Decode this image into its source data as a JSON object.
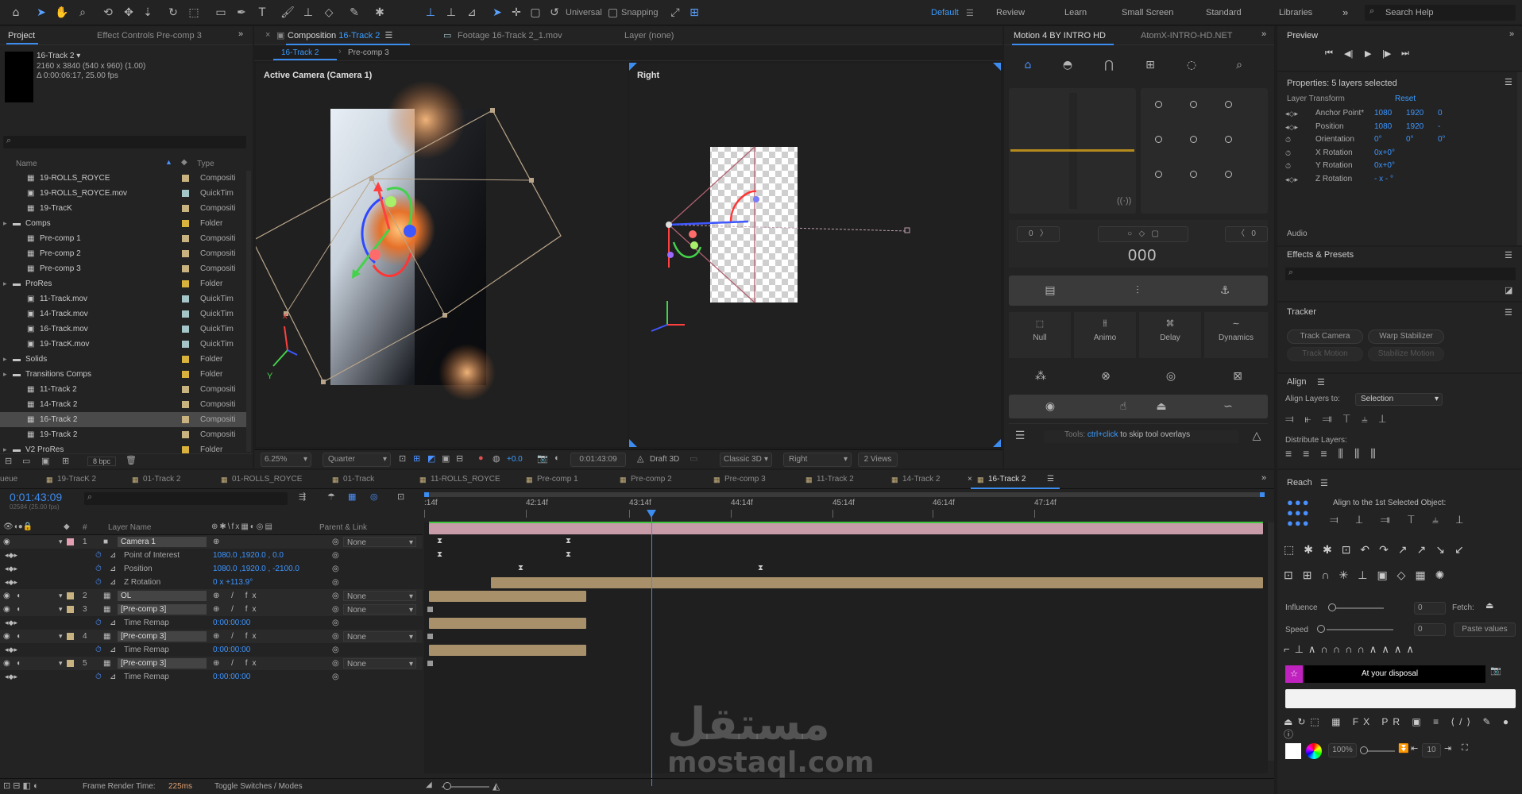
{
  "workspace": {
    "default": "Default",
    "review": "Review",
    "learn": "Learn",
    "small_screen": "Small Screen",
    "standard": "Standard",
    "libraries": "Libraries",
    "search": "Search Help"
  },
  "toolbar": {
    "universal": "Universal",
    "snapping": "Snapping"
  },
  "project": {
    "tab": "Project",
    "tab2": "Effect Controls Pre-comp 3",
    "selected_name": "16-Track 2 ▾",
    "selected_size": "2160 x 3840  (540 x 960) (1.00)",
    "selected_dur": "Δ 0:00:06:17, 25.00 fps",
    "col_name": "Name",
    "col_type": "Type",
    "bpc": "8 bpc",
    "items": [
      {
        "name": "19-ROLLS_ROYCE",
        "type": "Compositi",
        "color": "#c8b27f",
        "indent": 1,
        "icon": "comp"
      },
      {
        "name": "19-ROLLS_ROYCE.mov",
        "type": "QuickTim",
        "color": "#a5c6c9",
        "indent": 1,
        "icon": "mov"
      },
      {
        "name": "19-TracK",
        "type": "Compositi",
        "color": "#c8b27f",
        "indent": 1,
        "icon": "comp"
      },
      {
        "name": "Comps",
        "type": "Folder",
        "color": "#d8b23c",
        "indent": 0,
        "icon": "folder"
      },
      {
        "name": "Pre-comp 1",
        "type": "Compositi",
        "color": "#c8b27f",
        "indent": 1,
        "icon": "comp"
      },
      {
        "name": "Pre-comp 2",
        "type": "Compositi",
        "color": "#c8b27f",
        "indent": 1,
        "icon": "comp"
      },
      {
        "name": "Pre-comp 3",
        "type": "Compositi",
        "color": "#c8b27f",
        "indent": 1,
        "icon": "comp"
      },
      {
        "name": "ProRes",
        "type": "Folder",
        "color": "#d8b23c",
        "indent": 0,
        "icon": "folder"
      },
      {
        "name": "11-Track.mov",
        "type": "QuickTim",
        "color": "#a5c6c9",
        "indent": 1,
        "icon": "mov"
      },
      {
        "name": "14-Track.mov",
        "type": "QuickTim",
        "color": "#a5c6c9",
        "indent": 1,
        "icon": "mov"
      },
      {
        "name": "16-Track.mov",
        "type": "QuickTim",
        "color": "#a5c6c9",
        "indent": 1,
        "icon": "mov"
      },
      {
        "name": "19-TracK.mov",
        "type": "QuickTim",
        "color": "#a5c6c9",
        "indent": 1,
        "icon": "mov"
      },
      {
        "name": "Solids",
        "type": "Folder",
        "color": "#d8b23c",
        "indent": 0,
        "icon": "folder"
      },
      {
        "name": "Transitions Comps",
        "type": "Folder",
        "color": "#d8b23c",
        "indent": 0,
        "icon": "folder"
      },
      {
        "name": "11-Track 2",
        "type": "Compositi",
        "color": "#c8b27f",
        "indent": 1,
        "icon": "comp"
      },
      {
        "name": "14-Track 2",
        "type": "Compositi",
        "color": "#c8b27f",
        "indent": 1,
        "icon": "comp"
      },
      {
        "name": "16-Track 2",
        "type": "Compositi",
        "color": "#c8b27f",
        "indent": 1,
        "icon": "comp",
        "selected": true
      },
      {
        "name": "19-Track 2",
        "type": "Compositi",
        "color": "#c8b27f",
        "indent": 1,
        "icon": "comp"
      },
      {
        "name": "V2 ProRes",
        "type": "Folder",
        "color": "#d8b23c",
        "indent": 0,
        "icon": "folder"
      }
    ]
  },
  "comp": {
    "tab": "Composition",
    "tab_name": "16-Track 2",
    "footage_tab": "Footage 16-Track 2_1.mov",
    "layer_tab": "Layer (none)",
    "crumb1": "16-Track 2",
    "crumb2": "Pre-comp 3",
    "view_left": "Active Camera (Camera 1)",
    "view_right": "Right",
    "zoom": "6.25%",
    "res": "Quarter",
    "exposure": "+0.0",
    "time": "0:01:43:09",
    "draft": "Draft 3D",
    "renderer": "Classic 3D",
    "view_select": "Right",
    "views": "2 Views"
  },
  "motion": {
    "tab": "Motion 4 BY INTRO HD",
    "tab2": "AtomX-INTRO-HD.NET",
    "left_val": "0",
    "right_val": "0",
    "center": "000",
    "null": "Null",
    "animo": "Animo",
    "delay": "Delay",
    "dynamics": "Dynamics",
    "tools_hint_pre": "Tools: ",
    "tools_hint_key": "ctrl+click",
    "tools_hint_post": " to skip tool overlays"
  },
  "preview": {
    "tab": "Preview"
  },
  "properties": {
    "title": "Properties: 5 layers selected",
    "section": "Layer Transform",
    "reset": "Reset",
    "rows": [
      {
        "label": "Anchor Point*",
        "v1": "1080",
        "v2": "1920",
        "v3": "0"
      },
      {
        "label": "Position",
        "v1": "1080",
        "v2": "1920",
        "v3": "-"
      },
      {
        "label": "Orientation",
        "v1": "0°",
        "v2": "0°",
        "v3": "0°"
      },
      {
        "label": "X Rotation",
        "v1": "0x+0°",
        "v2": "",
        "v3": ""
      },
      {
        "label": "Y Rotation",
        "v1": "0x+0°",
        "v2": "",
        "v3": ""
      },
      {
        "label": "Z Rotation",
        "v1": "- x - °",
        "v2": "",
        "v3": ""
      }
    ],
    "audio": "Audio"
  },
  "effects": {
    "title": "Effects & Presets"
  },
  "tracker": {
    "title": "Tracker",
    "track_camera": "Track Camera",
    "warp": "Warp Stabilizer",
    "track_motion": "Track Motion",
    "stabilize": "Stabilize Motion"
  },
  "align": {
    "title": "Align",
    "align_to": "Align Layers to:",
    "selection": "Selection",
    "distribute": "Distribute Layers:"
  },
  "reach": {
    "title": "Reach",
    "align_first": "Align to the 1st Selected Object:",
    "influence": "Influence",
    "influence_val": "0",
    "fetch": "Fetch:",
    "speed": "Speed",
    "speed_val": "0",
    "paste": "Paste values",
    "disposal": "At your disposal",
    "pct": "100%",
    "count": "10"
  },
  "timeline": {
    "current_time": "0:01:43:09",
    "frames": "02584 (25.00 fps)",
    "tabs": [
      "ueue",
      "19-TracK 2",
      "01-Track 2",
      "01-ROLLS_ROYCE",
      "01-Track",
      "11-ROLLS_ROYCE",
      "Pre-comp 1",
      "Pre-comp 2",
      "Pre-comp 3",
      "11-Track 2",
      "14-Track 2",
      "16-Track 2"
    ],
    "col_layer": "Layer Name",
    "col_parent": "Parent & Link",
    "ticks": [
      ":14f",
      "42:14f",
      "43:14f",
      "44:14f",
      "45:14f",
      "46:14f",
      "47:14f"
    ],
    "layers": [
      {
        "num": "1",
        "name": "Camera 1",
        "parent": "None",
        "type": "camera",
        "color": "#e49fb3"
      },
      {
        "prop": "Point of Interest",
        "value": "1080.0 ,1920.0 , 0.0"
      },
      {
        "prop": "Position",
        "value": "1080.0 ,1920.0 , -2100.0"
      },
      {
        "prop": "Z Rotation",
        "value": "0 x +113.9°"
      },
      {
        "num": "2",
        "name": "OL",
        "parent": "None",
        "type": "layer",
        "color": "#c8b27f"
      },
      {
        "num": "3",
        "name": "[Pre-comp 3]",
        "parent": "None",
        "type": "layer",
        "color": "#c8b27f"
      },
      {
        "prop": "Time Remap",
        "value": "0:00:00:00"
      },
      {
        "num": "4",
        "name": "[Pre-comp 3]",
        "parent": "None",
        "type": "layer",
        "color": "#c8b27f"
      },
      {
        "prop": "Time Remap",
        "value": "0:00:00:00"
      },
      {
        "num": "5",
        "name": "[Pre-comp 3]",
        "parent": "None",
        "type": "layer",
        "color": "#c8b27f"
      },
      {
        "prop": "Time Remap",
        "value": "0:00:00:00"
      }
    ],
    "render_time_label": "Frame Render Time:",
    "render_time": "225ms",
    "toggle": "Toggle Switches / Modes"
  },
  "watermark": {
    "arabic": "مستقل",
    "latin": "mostaql.com"
  }
}
